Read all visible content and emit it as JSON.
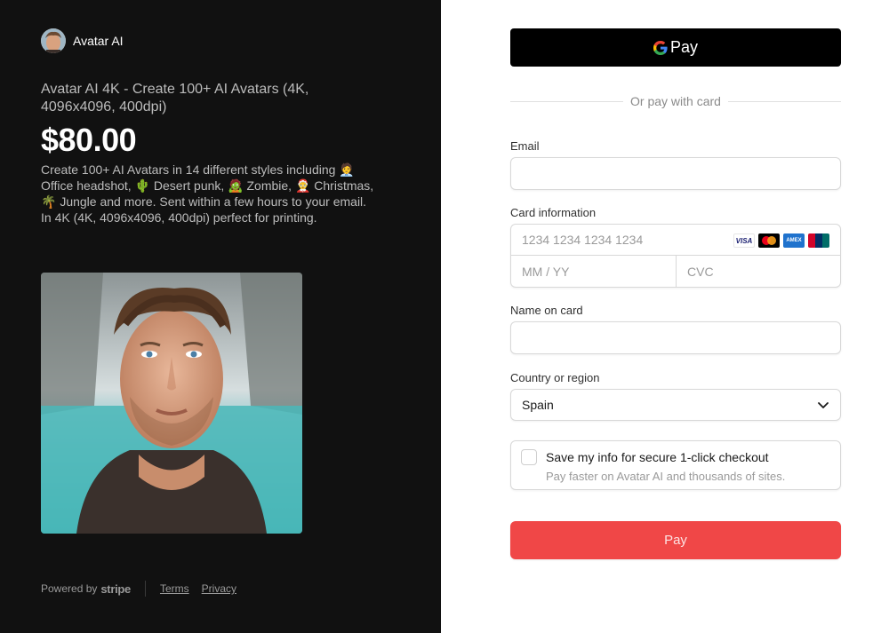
{
  "brand": {
    "name": "Avatar AI"
  },
  "product": {
    "name": "Avatar AI 4K - Create 100+ AI Avatars (4K, 4096x4096, 400dpi)",
    "price": "$80.00",
    "description": "Create 100+ AI Avatars in 14 different styles including 🧑‍💼 Office headshot, 🌵 Desert punk, 🧟 Zombie, 🤶 Christmas, 🌴 Jungle and more. Sent within a few hours to your email. In 4K (4K, 4096x4096, 400dpi) perfect for printing."
  },
  "footer": {
    "powered_by": "Powered by",
    "stripe": "stripe",
    "terms": "Terms",
    "privacy": "Privacy"
  },
  "payment": {
    "gpay_label": "Pay",
    "divider_text": "Or pay with card",
    "email_label": "Email",
    "email_value": "",
    "card_label": "Card information",
    "card_number_placeholder": "1234 1234 1234 1234",
    "expiry_placeholder": "MM / YY",
    "cvc_placeholder": "CVC",
    "card_brands": [
      "VISA",
      "Mastercard",
      "AMEX",
      "UnionPay"
    ],
    "name_label": "Name on card",
    "name_value": "",
    "country_label": "Country or region",
    "country_value": "Spain",
    "save_title": "Save my info for secure 1-click checkout",
    "save_subtitle": "Pay faster on Avatar AI and thousands of sites.",
    "save_checked": false,
    "pay_button": "Pay"
  },
  "colors": {
    "left_bg": "#111111",
    "pay_button_bg": "#f04747",
    "gpay_bg": "#000000"
  }
}
